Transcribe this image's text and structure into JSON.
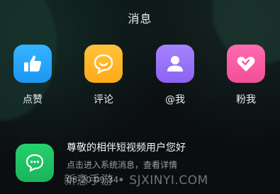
{
  "header": {
    "title": "消息"
  },
  "actions": [
    {
      "label": "点赞",
      "icon": "thumbs-up-icon",
      "color": "#1c96f2"
    },
    {
      "label": "评论",
      "icon": "smile-chat-icon",
      "color": "#ffaa1b"
    },
    {
      "label": "@我",
      "icon": "person-icon",
      "color": "#8c63f2"
    },
    {
      "label": "粉我",
      "icon": "heart-icon",
      "color": "#f24f98"
    }
  ],
  "message": {
    "icon": "chat-bubble-icon",
    "color": "#19b45a",
    "title": "尊敬的相伴短视频用户您好",
    "body": "点击进入系统消息，查看详情",
    "time": "08-20 09:34"
  },
  "watermark": "新意手游 • SJXINYI.COM"
}
